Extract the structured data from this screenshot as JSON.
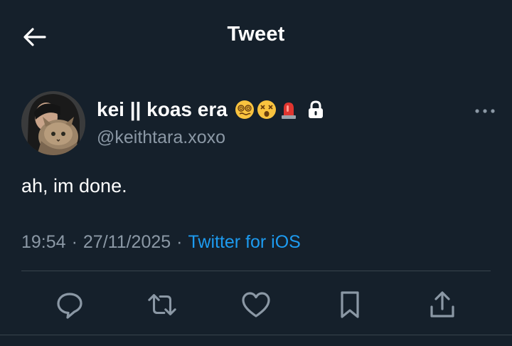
{
  "header": {
    "title": "Tweet"
  },
  "author": {
    "display_name": "kei || koas era",
    "emojis": [
      "woozy-face",
      "dizzy-face",
      "rotating-light"
    ],
    "locked": true,
    "handle": "@keithtara.xoxo"
  },
  "tweet": {
    "text": "ah, im done.",
    "time": "19:54",
    "date": "27/11/2025",
    "separator": "·",
    "source": "Twitter for iOS"
  },
  "actions": [
    "reply",
    "retweet",
    "like",
    "bookmark",
    "share"
  ],
  "colors": {
    "background": "#15202b",
    "text": "#ffffff",
    "secondary": "#8b98a5",
    "accent": "#1d9bf0",
    "divider": "#38444d"
  }
}
